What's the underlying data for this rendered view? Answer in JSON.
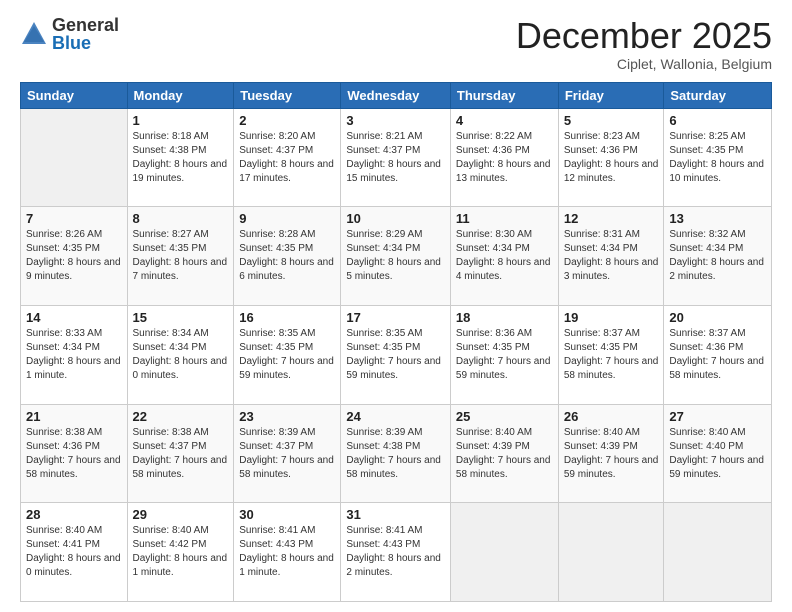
{
  "logo": {
    "general": "General",
    "blue": "Blue"
  },
  "header": {
    "month": "December 2025",
    "location": "Ciplet, Wallonia, Belgium"
  },
  "weekdays": [
    "Sunday",
    "Monday",
    "Tuesday",
    "Wednesday",
    "Thursday",
    "Friday",
    "Saturday"
  ],
  "weeks": [
    [
      {
        "day": "",
        "sunrise": "",
        "sunset": "",
        "daylight": ""
      },
      {
        "day": "1",
        "sunrise": "Sunrise: 8:18 AM",
        "sunset": "Sunset: 4:38 PM",
        "daylight": "Daylight: 8 hours and 19 minutes."
      },
      {
        "day": "2",
        "sunrise": "Sunrise: 8:20 AM",
        "sunset": "Sunset: 4:37 PM",
        "daylight": "Daylight: 8 hours and 17 minutes."
      },
      {
        "day": "3",
        "sunrise": "Sunrise: 8:21 AM",
        "sunset": "Sunset: 4:37 PM",
        "daylight": "Daylight: 8 hours and 15 minutes."
      },
      {
        "day": "4",
        "sunrise": "Sunrise: 8:22 AM",
        "sunset": "Sunset: 4:36 PM",
        "daylight": "Daylight: 8 hours and 13 minutes."
      },
      {
        "day": "5",
        "sunrise": "Sunrise: 8:23 AM",
        "sunset": "Sunset: 4:36 PM",
        "daylight": "Daylight: 8 hours and 12 minutes."
      },
      {
        "day": "6",
        "sunrise": "Sunrise: 8:25 AM",
        "sunset": "Sunset: 4:35 PM",
        "daylight": "Daylight: 8 hours and 10 minutes."
      }
    ],
    [
      {
        "day": "7",
        "sunrise": "Sunrise: 8:26 AM",
        "sunset": "Sunset: 4:35 PM",
        "daylight": "Daylight: 8 hours and 9 minutes."
      },
      {
        "day": "8",
        "sunrise": "Sunrise: 8:27 AM",
        "sunset": "Sunset: 4:35 PM",
        "daylight": "Daylight: 8 hours and 7 minutes."
      },
      {
        "day": "9",
        "sunrise": "Sunrise: 8:28 AM",
        "sunset": "Sunset: 4:35 PM",
        "daylight": "Daylight: 8 hours and 6 minutes."
      },
      {
        "day": "10",
        "sunrise": "Sunrise: 8:29 AM",
        "sunset": "Sunset: 4:34 PM",
        "daylight": "Daylight: 8 hours and 5 minutes."
      },
      {
        "day": "11",
        "sunrise": "Sunrise: 8:30 AM",
        "sunset": "Sunset: 4:34 PM",
        "daylight": "Daylight: 8 hours and 4 minutes."
      },
      {
        "day": "12",
        "sunrise": "Sunrise: 8:31 AM",
        "sunset": "Sunset: 4:34 PM",
        "daylight": "Daylight: 8 hours and 3 minutes."
      },
      {
        "day": "13",
        "sunrise": "Sunrise: 8:32 AM",
        "sunset": "Sunset: 4:34 PM",
        "daylight": "Daylight: 8 hours and 2 minutes."
      }
    ],
    [
      {
        "day": "14",
        "sunrise": "Sunrise: 8:33 AM",
        "sunset": "Sunset: 4:34 PM",
        "daylight": "Daylight: 8 hours and 1 minute."
      },
      {
        "day": "15",
        "sunrise": "Sunrise: 8:34 AM",
        "sunset": "Sunset: 4:34 PM",
        "daylight": "Daylight: 8 hours and 0 minutes."
      },
      {
        "day": "16",
        "sunrise": "Sunrise: 8:35 AM",
        "sunset": "Sunset: 4:35 PM",
        "daylight": "Daylight: 7 hours and 59 minutes."
      },
      {
        "day": "17",
        "sunrise": "Sunrise: 8:35 AM",
        "sunset": "Sunset: 4:35 PM",
        "daylight": "Daylight: 7 hours and 59 minutes."
      },
      {
        "day": "18",
        "sunrise": "Sunrise: 8:36 AM",
        "sunset": "Sunset: 4:35 PM",
        "daylight": "Daylight: 7 hours and 59 minutes."
      },
      {
        "day": "19",
        "sunrise": "Sunrise: 8:37 AM",
        "sunset": "Sunset: 4:35 PM",
        "daylight": "Daylight: 7 hours and 58 minutes."
      },
      {
        "day": "20",
        "sunrise": "Sunrise: 8:37 AM",
        "sunset": "Sunset: 4:36 PM",
        "daylight": "Daylight: 7 hours and 58 minutes."
      }
    ],
    [
      {
        "day": "21",
        "sunrise": "Sunrise: 8:38 AM",
        "sunset": "Sunset: 4:36 PM",
        "daylight": "Daylight: 7 hours and 58 minutes."
      },
      {
        "day": "22",
        "sunrise": "Sunrise: 8:38 AM",
        "sunset": "Sunset: 4:37 PM",
        "daylight": "Daylight: 7 hours and 58 minutes."
      },
      {
        "day": "23",
        "sunrise": "Sunrise: 8:39 AM",
        "sunset": "Sunset: 4:37 PM",
        "daylight": "Daylight: 7 hours and 58 minutes."
      },
      {
        "day": "24",
        "sunrise": "Sunrise: 8:39 AM",
        "sunset": "Sunset: 4:38 PM",
        "daylight": "Daylight: 7 hours and 58 minutes."
      },
      {
        "day": "25",
        "sunrise": "Sunrise: 8:40 AM",
        "sunset": "Sunset: 4:39 PM",
        "daylight": "Daylight: 7 hours and 58 minutes."
      },
      {
        "day": "26",
        "sunrise": "Sunrise: 8:40 AM",
        "sunset": "Sunset: 4:39 PM",
        "daylight": "Daylight: 7 hours and 59 minutes."
      },
      {
        "day": "27",
        "sunrise": "Sunrise: 8:40 AM",
        "sunset": "Sunset: 4:40 PM",
        "daylight": "Daylight: 7 hours and 59 minutes."
      }
    ],
    [
      {
        "day": "28",
        "sunrise": "Sunrise: 8:40 AM",
        "sunset": "Sunset: 4:41 PM",
        "daylight": "Daylight: 8 hours and 0 minutes."
      },
      {
        "day": "29",
        "sunrise": "Sunrise: 8:40 AM",
        "sunset": "Sunset: 4:42 PM",
        "daylight": "Daylight: 8 hours and 1 minute."
      },
      {
        "day": "30",
        "sunrise": "Sunrise: 8:41 AM",
        "sunset": "Sunset: 4:43 PM",
        "daylight": "Daylight: 8 hours and 1 minute."
      },
      {
        "day": "31",
        "sunrise": "Sunrise: 8:41 AM",
        "sunset": "Sunset: 4:43 PM",
        "daylight": "Daylight: 8 hours and 2 minutes."
      },
      {
        "day": "",
        "sunrise": "",
        "sunset": "",
        "daylight": ""
      },
      {
        "day": "",
        "sunrise": "",
        "sunset": "",
        "daylight": ""
      },
      {
        "day": "",
        "sunrise": "",
        "sunset": "",
        "daylight": ""
      }
    ]
  ]
}
